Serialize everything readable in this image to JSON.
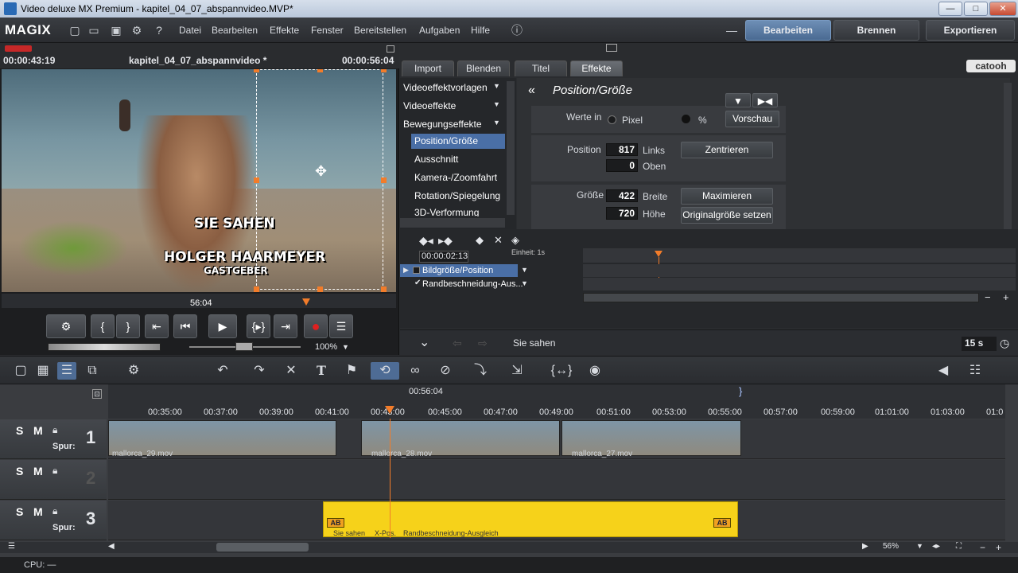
{
  "window": {
    "title": "Video deluxe MX Premium - kapitel_04_07_abspannvideo.MVP*"
  },
  "menubar": {
    "logo": "MAGIX",
    "menus": [
      "Datei",
      "Bearbeiten",
      "Effekte",
      "Fenster",
      "Bereitstellen",
      "Aufgaben",
      "Hilfe"
    ],
    "modes": {
      "edit": "Bearbeiten",
      "burn": "Brennen",
      "export": "Exportieren"
    }
  },
  "preview": {
    "time_left": "00:00:43:19",
    "project_name": "kapitel_04_07_abspannvideo *",
    "time_right": "00:00:56:04",
    "overlay_line1": "SIE SAHEN",
    "overlay_line2": "HOLGER HAARMEYER",
    "overlay_line3": "GASTGEBER",
    "scrub_time": "56:04",
    "zoom": "100%"
  },
  "effects": {
    "tabs": [
      "Import",
      "Blenden",
      "Titel",
      "Effekte"
    ],
    "brand": "catooh",
    "list": [
      "Videoeffektvorlagen",
      "Videoeffekte",
      "Bewegungseffekte"
    ],
    "sublist": [
      "Position/Größe",
      "Ausschnitt",
      "Kamera-/Zoomfahrt",
      "Rotation/Spiegelung",
      "3D-Verformung"
    ],
    "panel_title": "Position/Größe",
    "values_in_label": "Werte in",
    "unit_pixel": "Pixel",
    "unit_percent": "%",
    "preview_btn": "Vorschau",
    "position_label": "Position",
    "pos_x": "817",
    "pos_x_lbl": "Links",
    "pos_y": "0",
    "pos_y_lbl": "Oben",
    "center_btn": "Zentrieren",
    "size_label": "Größe",
    "width": "422",
    "width_lbl": "Breite",
    "height": "720",
    "height_lbl": "Höhe",
    "maximize_btn": "Maximieren",
    "original_btn": "Originalgröße setzen",
    "kf_time": "00:00:02:13",
    "kf_unit": "Einheit: 1s",
    "kf_track1": "Bildgröße/Position",
    "kf_track2": "Randbeschneidung-Aus...",
    "footer_label": "Sie sahen",
    "duration": "15 s"
  },
  "timeline": {
    "ruler_center": "00:56:04",
    "ticks": [
      "00:35:00",
      "00:37:00",
      "00:39:00",
      "00:41:00",
      "00:43:00",
      "00:45:00",
      "00:47:00",
      "00:49:00",
      "00:51:00",
      "00:53:00",
      "00:55:00",
      "00:57:00",
      "00:59:00",
      "01:01:00",
      "01:03:00",
      "01:0"
    ],
    "track_label": "Spur:",
    "tracks": [
      "1",
      "2",
      "3"
    ],
    "clips": [
      "mallorca_29.mov",
      "mallorca_28.mov",
      "mallorca_27.mov"
    ],
    "title_clip_labels": [
      "Sie sahen",
      "X-Pos.",
      "Randbeschneidung-Ausgleich"
    ],
    "zoom": "56%"
  },
  "status": {
    "cpu": "CPU: —"
  }
}
